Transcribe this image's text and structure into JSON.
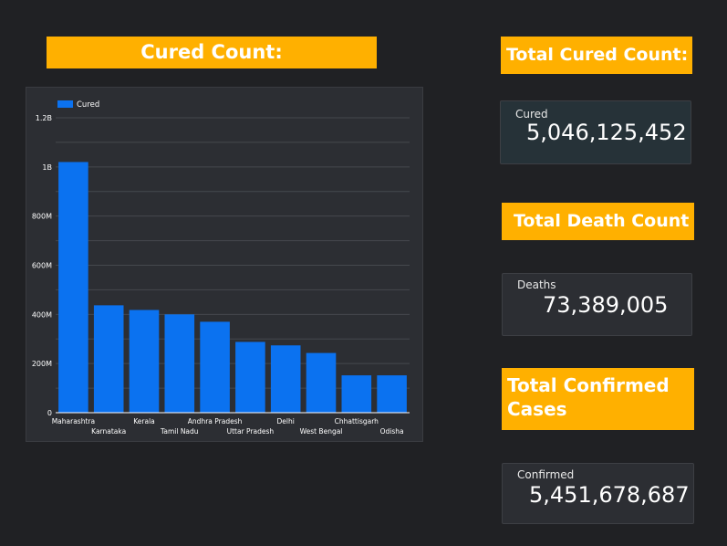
{
  "headers": {
    "chart_title": "Cured Count:",
    "total_cured": "Total Cured Count:",
    "total_death": "Total Death Count",
    "total_confirmed": "Total Confirmed Cases"
  },
  "scorecards": {
    "cured": {
      "label": "Cured",
      "value": "5,046,125,452"
    },
    "deaths": {
      "label": "Deaths",
      "value": "73,389,005"
    },
    "confirmed": {
      "label": "Confirmed",
      "value": "5,451,678,687"
    }
  },
  "colors": {
    "banner": "#FFB000",
    "bar": "#0B72F0",
    "background": "#202124",
    "panel": "#2C2E33"
  },
  "chart_data": {
    "type": "bar",
    "legend": "top-left",
    "grid": true,
    "categories": [
      "Maharashtra",
      "Karnataka",
      "Kerala",
      "Tamil Nadu",
      "Andhra Pradesh",
      "Uttar Pradesh",
      "Delhi",
      "West Bengal",
      "Chhattisgarh",
      "Odisha"
    ],
    "series": [
      {
        "name": "Cured",
        "values": [
          1020000000,
          437000000,
          418000000,
          400000000,
          370000000,
          288000000,
          274000000,
          243000000,
          152000000,
          152000000
        ]
      }
    ],
    "ylim": [
      0,
      1200000000
    ],
    "yticks": [
      0,
      200000000,
      400000000,
      600000000,
      800000000,
      1000000000,
      1200000000
    ],
    "ytick_labels": [
      "0",
      "200M",
      "400M",
      "600M",
      "800M",
      "1B",
      "1.2B"
    ],
    "xlabel": "",
    "ylabel": ""
  }
}
